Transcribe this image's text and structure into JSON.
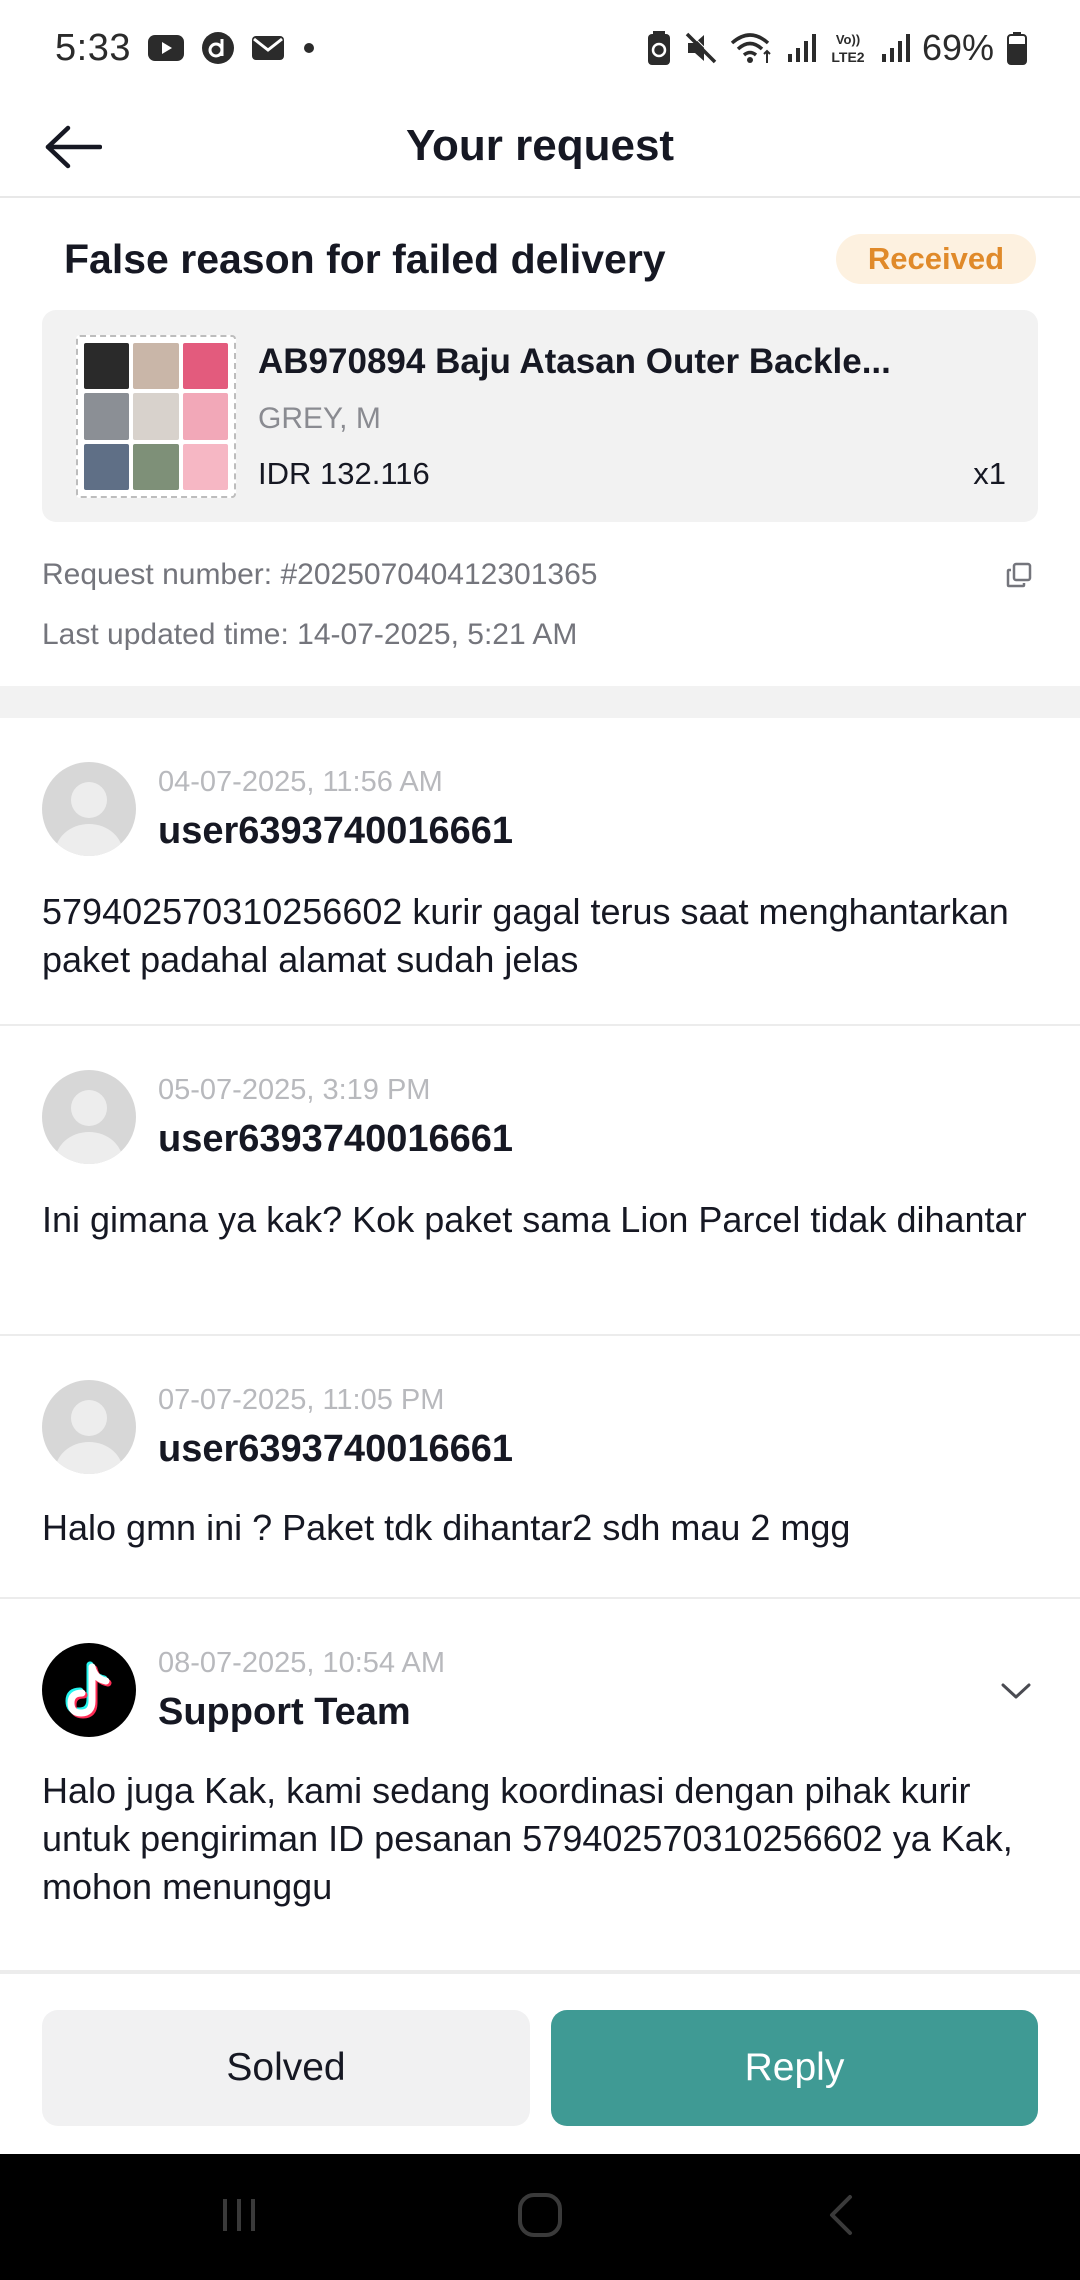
{
  "status_bar": {
    "time": "5:33",
    "battery_percent": "69%",
    "left_icons": [
      "youtube-icon",
      "d-app-icon",
      "mail-icon",
      "dot-icon"
    ],
    "right_icons": [
      "battery-saver-icon",
      "mute-icon",
      "wifi-icon",
      "signal-icon",
      "volte-lte2-icon",
      "signal-icon",
      "battery-icon"
    ],
    "volte_label": "Vo)) LTE2"
  },
  "header": {
    "title": "Your request",
    "back_icon": "arrow-left-icon"
  },
  "request": {
    "title": "False reason for failed delivery",
    "status": "Received",
    "product": {
      "name": "AB970894 Baju Atasan Outer Backle...",
      "variant": "GREY, M",
      "price": "IDR 132.116",
      "quantity": "x1"
    },
    "request_number": "Request number: #202507040412301365",
    "last_updated": "Last updated time: 14-07-2025, 5:21 AM"
  },
  "messages": [
    {
      "time": "04-07-2025, 11:56 AM",
      "author": "user6393740016661",
      "text": "579402570310256602 kurir gagal terus saat menghantarkan paket padahal alamat sudah jelas",
      "avatar": "default-user-avatar"
    },
    {
      "time": "05-07-2025, 3:19 PM",
      "author": "user6393740016661",
      "text": "Ini gimana ya kak? Kok paket sama Lion Parcel tidak dihantar",
      "avatar": "default-user-avatar"
    },
    {
      "time": "07-07-2025, 11:05 PM",
      "author": "user6393740016661",
      "text": "Halo gmn ini ? Paket tdk dihantar2 sdh mau 2 mgg",
      "avatar": "default-user-avatar"
    },
    {
      "time": "08-07-2025, 10:54 AM",
      "author": "Support Team",
      "text": "Halo juga Kak, kami sedang koordinasi dengan pihak kurir untuk pengiriman ID pesanan 579402570310256602 ya Kak, mohon menunggu",
      "avatar": "tiktok-logo"
    }
  ],
  "actions": {
    "solved_label": "Solved",
    "reply_label": "Reply"
  },
  "colors": {
    "badge_bg": "#fdf1e0",
    "badge_text": "#e08a2a",
    "reply_button": "#3f9a94",
    "card_bg": "#f2f2f2"
  },
  "nav_bar": {
    "icons": [
      "recents-icon",
      "home-icon",
      "back-icon"
    ]
  }
}
